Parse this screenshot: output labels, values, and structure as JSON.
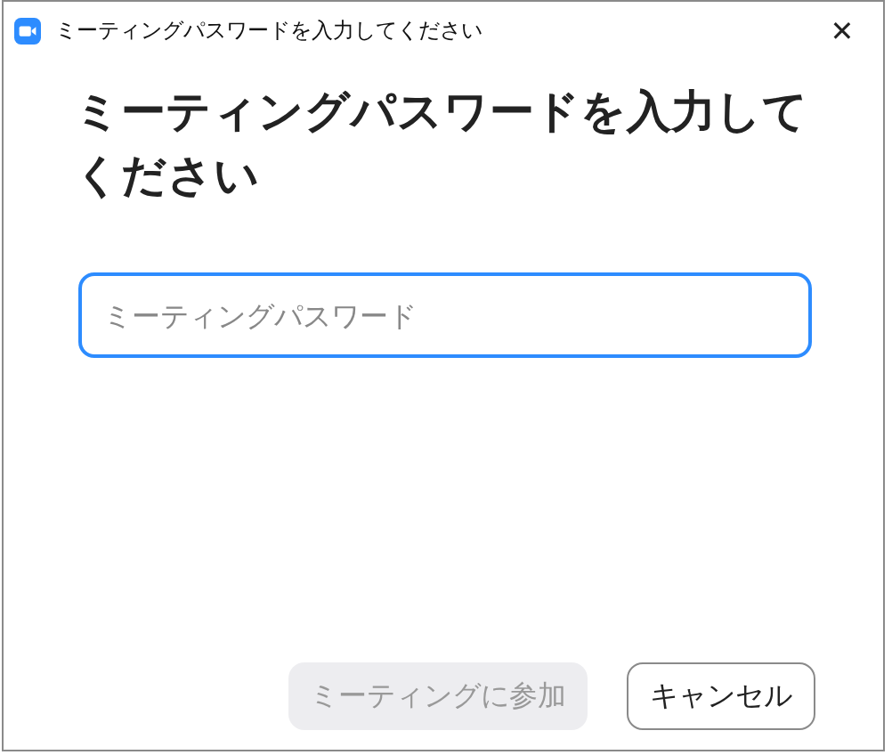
{
  "window": {
    "title": "ミーティングパスワードを入力してください",
    "close": "✕"
  },
  "heading": "ミーティングパスワードを入力してください",
  "password_field": {
    "placeholder": "ミーティングパスワード",
    "focused": true
  },
  "buttons": [
    {
      "kind": "primary",
      "label": "ミーティングに参加",
      "disabled": true
    },
    {
      "kind": "secondary",
      "label": "キャンセル",
      "disabled": false
    }
  ]
}
